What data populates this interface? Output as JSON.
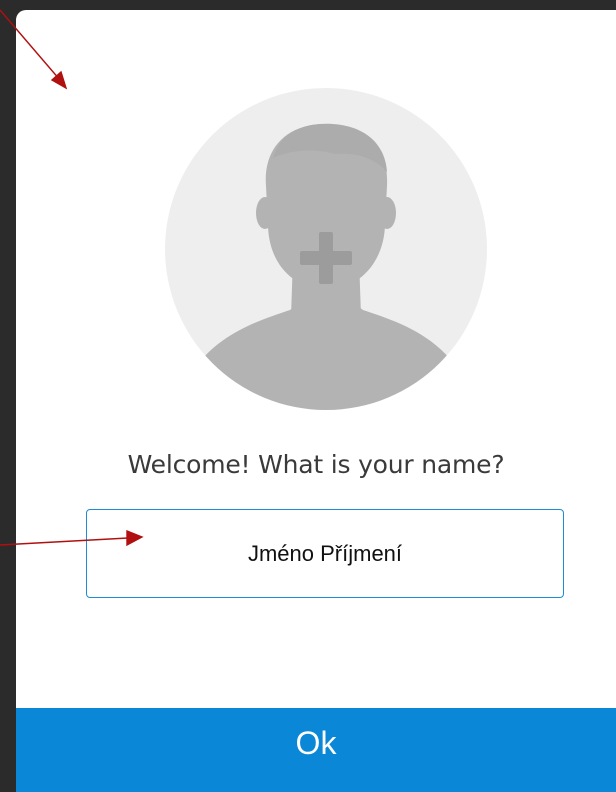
{
  "dialog": {
    "welcome_text": "Welcome! What is your name?",
    "name_input_value": "Jméno Příjmení",
    "ok_label": "Ok"
  },
  "avatar": {
    "icon": "user-placeholder-add-icon"
  },
  "colors": {
    "accent": "#0a87d6",
    "input_border": "#1f8bd6",
    "avatar_bg": "#eeeeee",
    "silhouette": "#b3b3b3",
    "annotation_arrow": "#b01010",
    "frame_bg": "#2b2b2b"
  }
}
